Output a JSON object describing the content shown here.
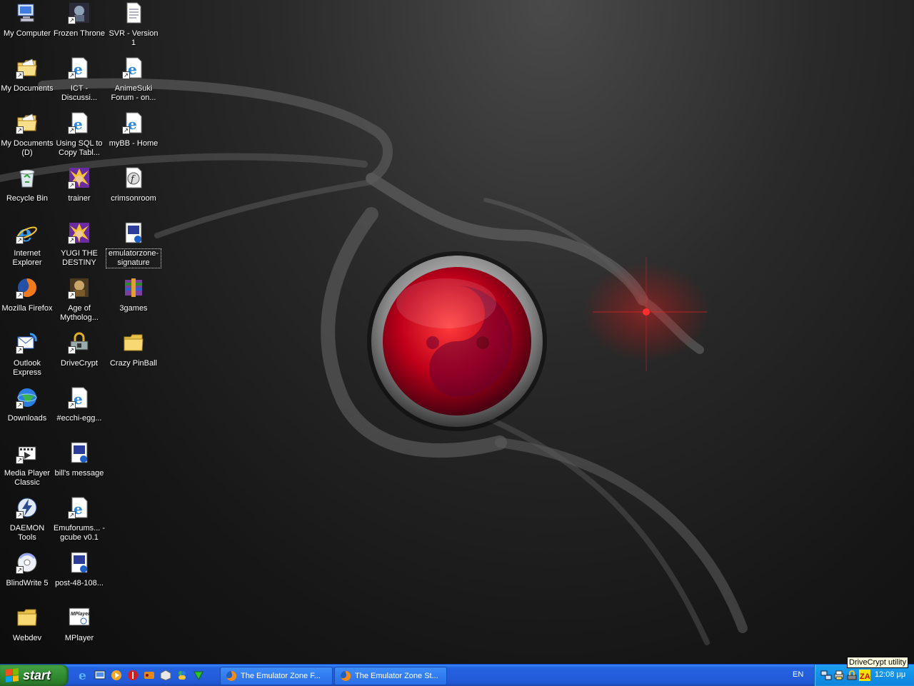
{
  "desktop": {
    "icons": [
      {
        "label": "My Computer",
        "icon": "my-computer-icon"
      },
      {
        "label": "Frozen Throne",
        "icon": "frozen-throne-icon"
      },
      {
        "label": "SVR - Version 1",
        "icon": "text-document-icon"
      },
      {
        "label": "My Documents",
        "icon": "my-documents-folder-icon"
      },
      {
        "label": "ICT - Discussi...",
        "icon": "internet-shortcut-icon"
      },
      {
        "label": "AnimeSuki Forum - on...",
        "icon": "internet-shortcut-icon"
      },
      {
        "label": "My Documents (D)",
        "icon": "my-documents-folder-icon"
      },
      {
        "label": "Using SQL to Copy Tabl...",
        "icon": "internet-shortcut-icon"
      },
      {
        "label": "myBB - Home",
        "icon": "internet-shortcut-icon"
      },
      {
        "label": "Recycle Bin",
        "icon": "recycle-bin-icon"
      },
      {
        "label": "trainer",
        "icon": "yugioh-icon"
      },
      {
        "label": "crimsonroom",
        "icon": "flash-movie-icon"
      },
      {
        "label": "Internet Explorer",
        "icon": "internet-explorer-icon"
      },
      {
        "label": "YUGI THE DESTINY",
        "icon": "yugioh-icon"
      },
      {
        "label": "emulatorzone-signature",
        "icon": "image-file-icon"
      },
      {
        "label": "Mozilla Firefox",
        "icon": "firefox-icon"
      },
      {
        "label": "Age of Mytholog...",
        "icon": "age-of-mythology-icon"
      },
      {
        "label": "3games",
        "icon": "winrar-archive-icon"
      },
      {
        "label": "Outlook Express",
        "icon": "outlook-express-icon"
      },
      {
        "label": "DriveCrypt",
        "icon": "drivecrypt-icon"
      },
      {
        "label": "Crazy PinBall",
        "icon": "folder-icon"
      },
      {
        "label": "Downloads",
        "icon": "downloads-globe-icon"
      },
      {
        "label": "#ecchi-egg...",
        "icon": "internet-shortcut-icon"
      },
      {
        "label": "Media Player Classic",
        "icon": "media-player-classic-icon"
      },
      {
        "label": "bill's message",
        "icon": "image-file-icon"
      },
      {
        "label": "DAEMON Tools",
        "icon": "daemon-tools-icon"
      },
      {
        "label": "Emuforums... - gcube v0.1",
        "icon": "internet-shortcut-icon"
      },
      {
        "label": "BlindWrite 5",
        "icon": "blindwrite-icon"
      },
      {
        "label": "post-48-108...",
        "icon": "image-file-icon"
      },
      {
        "label": "Webdev",
        "icon": "folder-icon"
      },
      {
        "label": "MPlayer",
        "icon": "mplayer-icon"
      }
    ]
  },
  "taskbar": {
    "start_label": "start",
    "quick_launch": [
      "internet-explorer-icon",
      "show-desktop-icon",
      "media-player-icon",
      "antivirus-icon",
      "game-icon",
      "package-icon",
      "messenger-icon",
      "green-arrow-icon"
    ],
    "windows": [
      {
        "title": "The Emulator Zone F...",
        "icon": "firefox-icon"
      },
      {
        "title": "The Emulator Zone St...",
        "icon": "firefox-icon"
      }
    ],
    "language": "EN",
    "tray_icons": [
      "network-icon",
      "printer-icon",
      "drivecrypt-tray-icon",
      "zonealarm-icon"
    ],
    "clock": "12:08 μμ",
    "tooltip": "DriveCrypt utility"
  },
  "colors": {
    "taskbar": "#245edc",
    "start": "#3c9a3c",
    "tray": "#1290e8",
    "orb": "#c8001e"
  }
}
